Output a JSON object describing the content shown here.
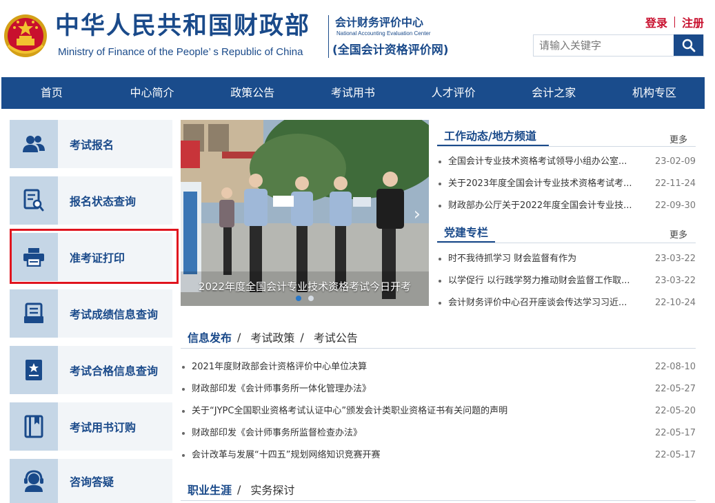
{
  "header": {
    "ministry_cn": "中华人民共和国财政部",
    "ministry_en": "Ministry of Finance of the People’ s Republic of China",
    "center_cn": "会计财务评价中心",
    "center_en": "National Accounting Evaluation Center",
    "center_sub": "(全国会计资格评价网)",
    "login": "登录",
    "register": "注册",
    "search_placeholder": "请输入关键字"
  },
  "nav": [
    "首页",
    "中心简介",
    "政策公告",
    "考试用书",
    "人才评价",
    "会计之家",
    "机构专区"
  ],
  "sidebar": [
    {
      "label": "考试报名",
      "icon": "users-icon"
    },
    {
      "label": "报名状态查询",
      "icon": "document-search-icon"
    },
    {
      "label": "准考证打印",
      "icon": "printer-icon"
    },
    {
      "label": "考试成绩信息查询",
      "icon": "score-report-icon"
    },
    {
      "label": "考试合格信息查询",
      "icon": "certificate-icon"
    },
    {
      "label": "考试用书订购",
      "icon": "book-icon"
    },
    {
      "label": "咨询答疑",
      "icon": "headset-icon"
    }
  ],
  "banner": {
    "caption": "2022年度全国会计专业技术资格考试今日开考"
  },
  "work_news": {
    "title": "工作动态/地方频道",
    "more": "更多",
    "items": [
      {
        "title": "全国会计专业技术资格考试领导小组办公室...",
        "date": "23-02-09"
      },
      {
        "title": "关于2023年度全国会计专业技术资格考试考...",
        "date": "22-11-24"
      },
      {
        "title": "财政部办公厅关于2022年度全国会计专业技...",
        "date": "22-09-30"
      }
    ]
  },
  "party": {
    "title": "党建专栏",
    "more": "更多",
    "items": [
      {
        "title": "时不我待抓学习 财会监督有作为",
        "date": "23-03-22"
      },
      {
        "title": "以学促行 以行践学努力推动财会监督工作取...",
        "date": "23-03-22"
      },
      {
        "title": "会计财务评价中心召开座谈会传达学习习近...",
        "date": "22-10-24"
      }
    ]
  },
  "info": {
    "tabs": [
      "信息发布",
      "考试政策",
      "考试公告"
    ],
    "items": [
      {
        "title": "2021年度财政部会计资格评价中心单位决算",
        "date": "22-08-10"
      },
      {
        "title": "财政部印发《会计师事务所一体化管理办法》",
        "date": "22-05-27"
      },
      {
        "title": "关于“JYPC全国职业资格考试认证中心”颁发会计类职业资格证书有关问题的声明",
        "date": "22-05-20"
      },
      {
        "title": "财政部印发《会计师事务所监督检查办法》",
        "date": "22-05-17"
      },
      {
        "title": "会计改革与发展“十四五”规划网络知识竞赛开赛",
        "date": "22-05-17"
      }
    ]
  },
  "career": {
    "tabs": [
      "职业生涯",
      "实务探讨"
    ]
  },
  "colors": {
    "primary": "#1a4a8a",
    "nav": "#1a4c8c",
    "accent_red": "#c8102e",
    "highlight": "#e0141e"
  }
}
